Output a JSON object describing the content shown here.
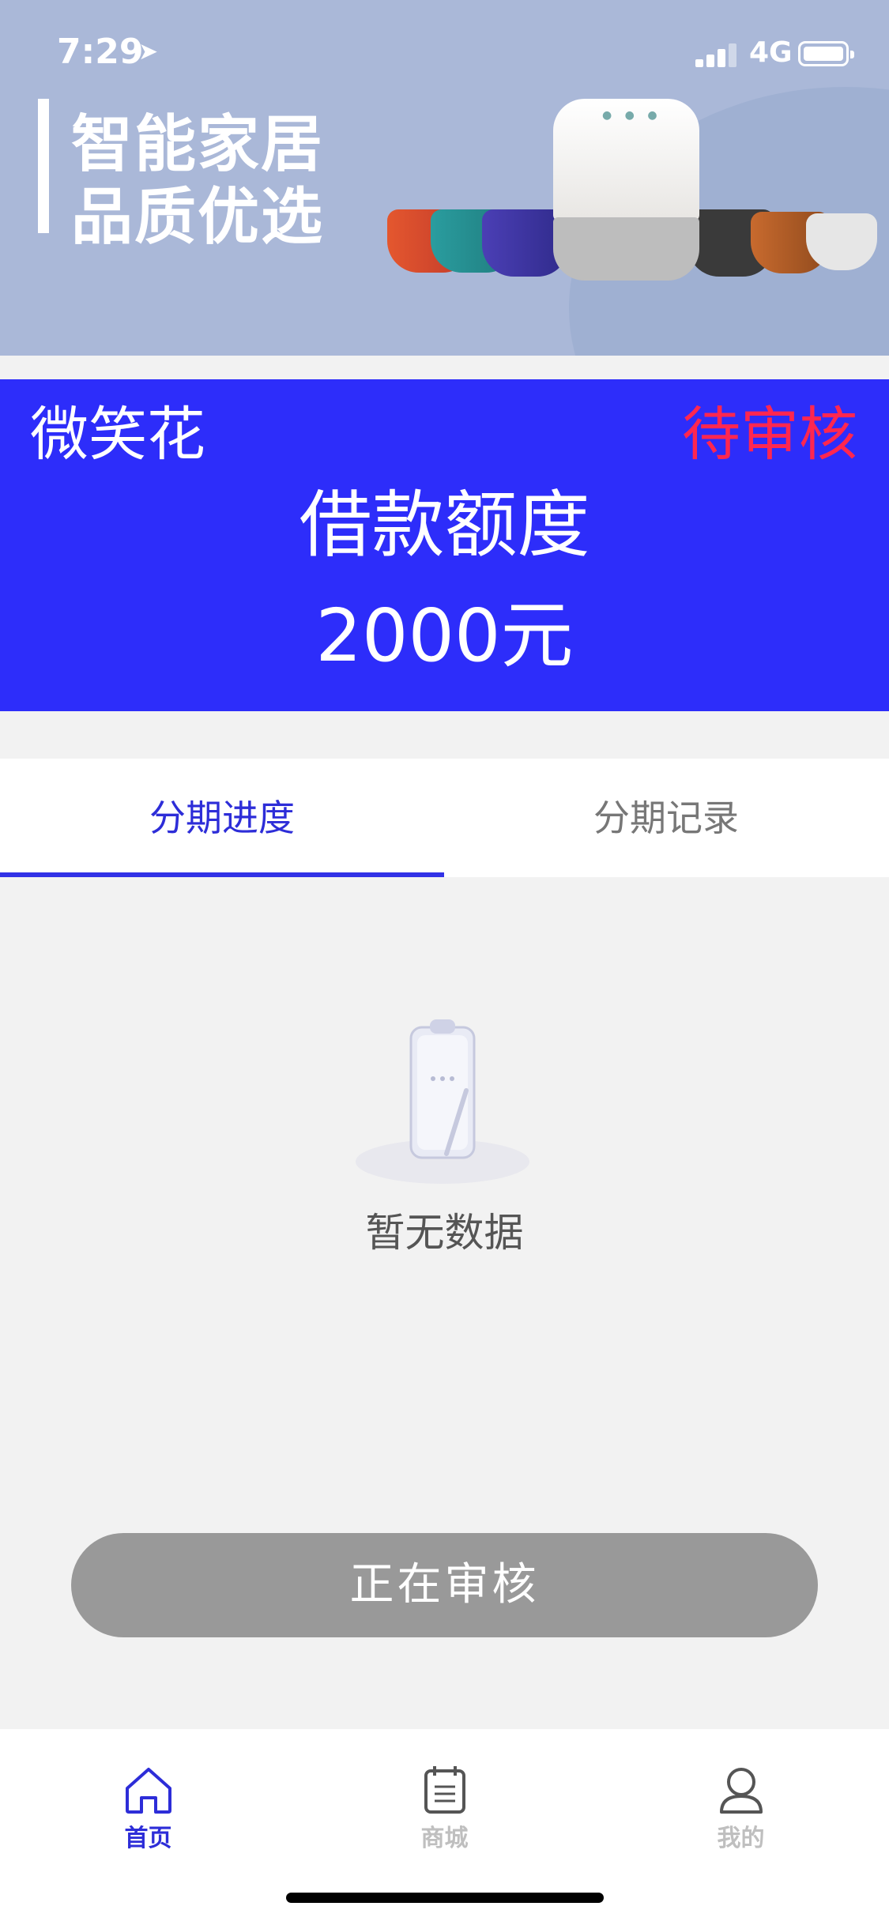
{
  "status_bar": {
    "time": "7:29",
    "network": "4G"
  },
  "banner": {
    "line1": "智能家居",
    "line2": "品质优选"
  },
  "loan_card": {
    "brand": "微笑花",
    "status": "待审核",
    "limit_label": "借款额度",
    "limit_value": "2000元",
    "colors": {
      "background": "#2d2dfa",
      "status": "#ff2650"
    }
  },
  "tabs": [
    {
      "label": "分期进度",
      "active": true
    },
    {
      "label": "分期记录",
      "active": false
    }
  ],
  "empty_state": {
    "text": "暂无数据",
    "icon": "empty-clipboard-icon"
  },
  "action_button": {
    "label": "正在审核",
    "color": "#999999"
  },
  "bottom_nav": [
    {
      "label": "首页",
      "icon": "home-icon",
      "active": true
    },
    {
      "label": "商城",
      "icon": "calendar-icon",
      "active": false
    },
    {
      "label": "我的",
      "icon": "user-icon",
      "active": false
    }
  ]
}
